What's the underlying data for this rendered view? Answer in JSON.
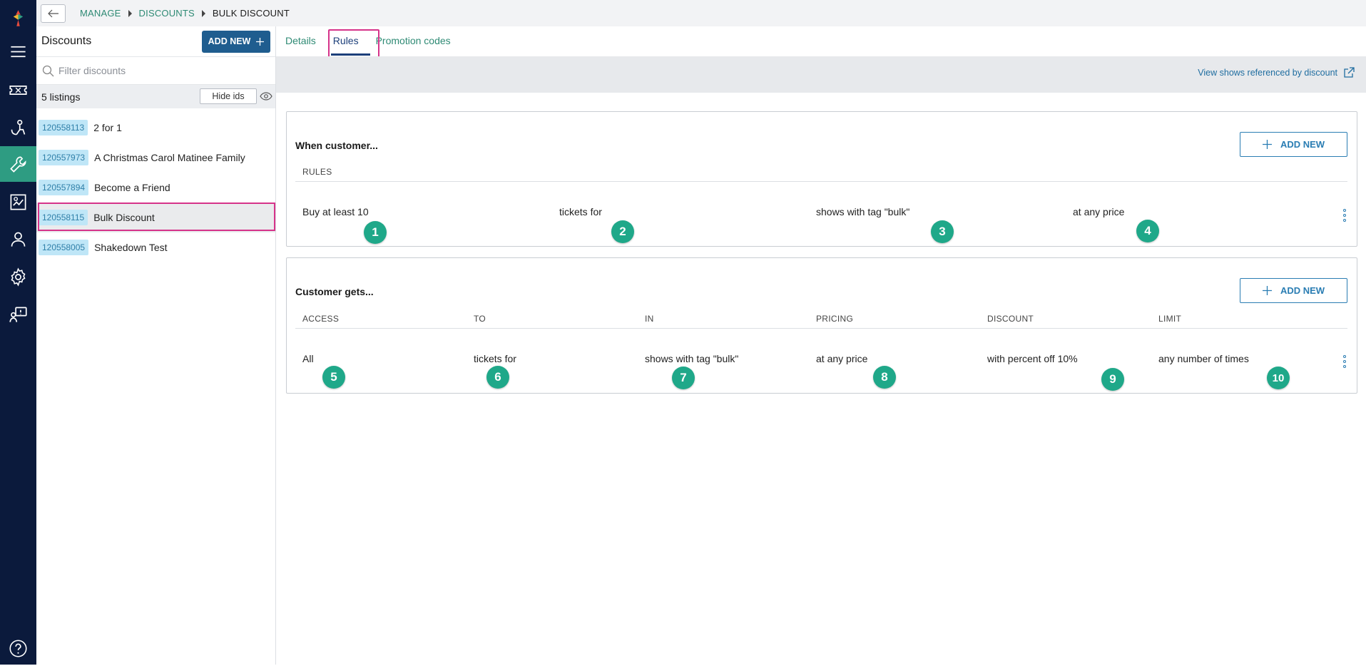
{
  "breadcrumb": {
    "items": [
      "MANAGE",
      "DISCOUNTS",
      "BULK DISCOUNT"
    ]
  },
  "discounts_panel": {
    "title": "Discounts",
    "add_new_label": "ADD NEW",
    "filter_placeholder": "Filter discounts",
    "listings_count": "5 listings",
    "hide_ids_label": "Hide ids",
    "items": [
      {
        "id": "120558113",
        "name": "2 for 1"
      },
      {
        "id": "120557973",
        "name": "A Christmas Carol Matinee Family"
      },
      {
        "id": "120557894",
        "name": "Become a Friend"
      },
      {
        "id": "120558115",
        "name": "Bulk Discount"
      },
      {
        "id": "120558005",
        "name": "Shakedown Test"
      }
    ],
    "selected_index": 3
  },
  "tabs": [
    {
      "label": "Details"
    },
    {
      "label": "Rules"
    },
    {
      "label": "Promotion codes"
    }
  ],
  "active_tab": "Rules",
  "view_shows_link": "View shows referenced by discount",
  "when_customer": {
    "title": "When customer...",
    "add_new_label": "ADD NEW",
    "header": "RULES",
    "row": [
      "Buy at least 10",
      "tickets for",
      "shows with tag \"bulk\"",
      "at any price"
    ]
  },
  "customer_gets": {
    "title": "Customer gets...",
    "add_new_label": "ADD NEW",
    "headers": [
      "ACCESS",
      "TO",
      "IN",
      "PRICING",
      "DISCOUNT",
      "LIMIT"
    ],
    "row": [
      "All",
      "tickets for",
      "shows with tag \"bulk\"",
      "at any price",
      "with percent off 10%",
      "any number of times"
    ]
  },
  "annotation_badges": [
    "1",
    "2",
    "3",
    "4",
    "5",
    "6",
    "7",
    "8",
    "9",
    "10"
  ],
  "colors": {
    "rail_bg": "#0b1a3c",
    "rail_active": "#2e9c82",
    "accent_green": "#2e8a74",
    "primary_blue": "#1f5d8f",
    "highlight_pink": "#d6338a",
    "badge_teal": "#1fa889"
  },
  "icons": {
    "rail": [
      "logo-icon",
      "menu-icon",
      "ticket-icon",
      "person-seat-icon",
      "wrench-icon",
      "chart-icon",
      "user-icon",
      "gear-icon",
      "feedback-icon",
      "help-icon"
    ],
    "back": "arrow-left-icon",
    "search": "search-icon",
    "eye": "eye-icon",
    "external": "external-link-icon",
    "plus": "plus-icon",
    "kebab": "kebab-icon"
  }
}
